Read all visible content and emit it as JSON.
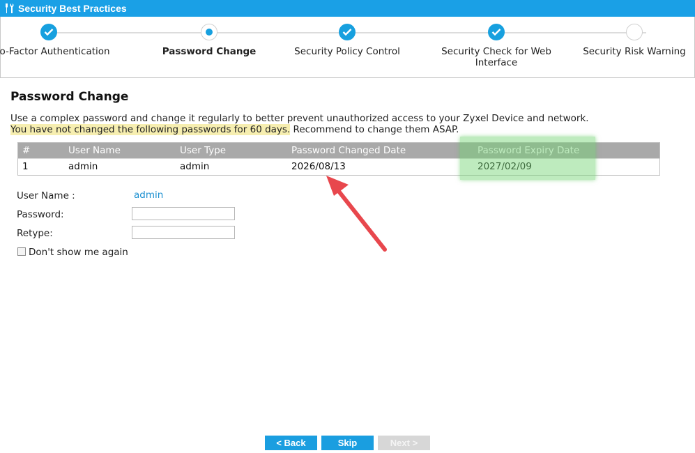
{
  "window": {
    "title": "Security Best Practices",
    "title_icon": "tools-icon"
  },
  "steps": [
    {
      "label": "Two-Factor Authentication",
      "state": "done"
    },
    {
      "label": "Password Change",
      "state": "current"
    },
    {
      "label": "Security Policy Control",
      "state": "done"
    },
    {
      "label": "Security Check for Web Interface",
      "state": "done"
    },
    {
      "label": "Security Risk Warning",
      "state": "todo"
    }
  ],
  "page": {
    "title": "Password Change",
    "description_line1": "Use a complex password and change it regularly to better prevent unauthorized access to your Zyxel Device and network.",
    "description_highlight": "You have not changed the following passwords for 60 days.",
    "description_rest": " Recommend to change them ASAP."
  },
  "table": {
    "headers": [
      "#",
      "User Name",
      "User Type",
      "Password Changed Date",
      "Password Expiry Date"
    ],
    "rows": [
      [
        "1",
        "admin",
        "admin",
        "2026/08/13",
        "2027/02/09"
      ]
    ]
  },
  "form": {
    "username_label": "User Name :",
    "username_value": "admin",
    "password_label": "Password:",
    "password_value": "",
    "retype_label": "Retype:",
    "retype_value": "",
    "dont_show_label": "Don't show me again",
    "dont_show_checked": false
  },
  "buttons": {
    "back": "< Back",
    "skip": "Skip",
    "next": "Next >"
  },
  "colors": {
    "accent": "#1aa0e6",
    "annotation_arrow": "#e8474d",
    "highlight_yellow": "#f6eeb0",
    "highlight_green": "#6ed26e"
  }
}
